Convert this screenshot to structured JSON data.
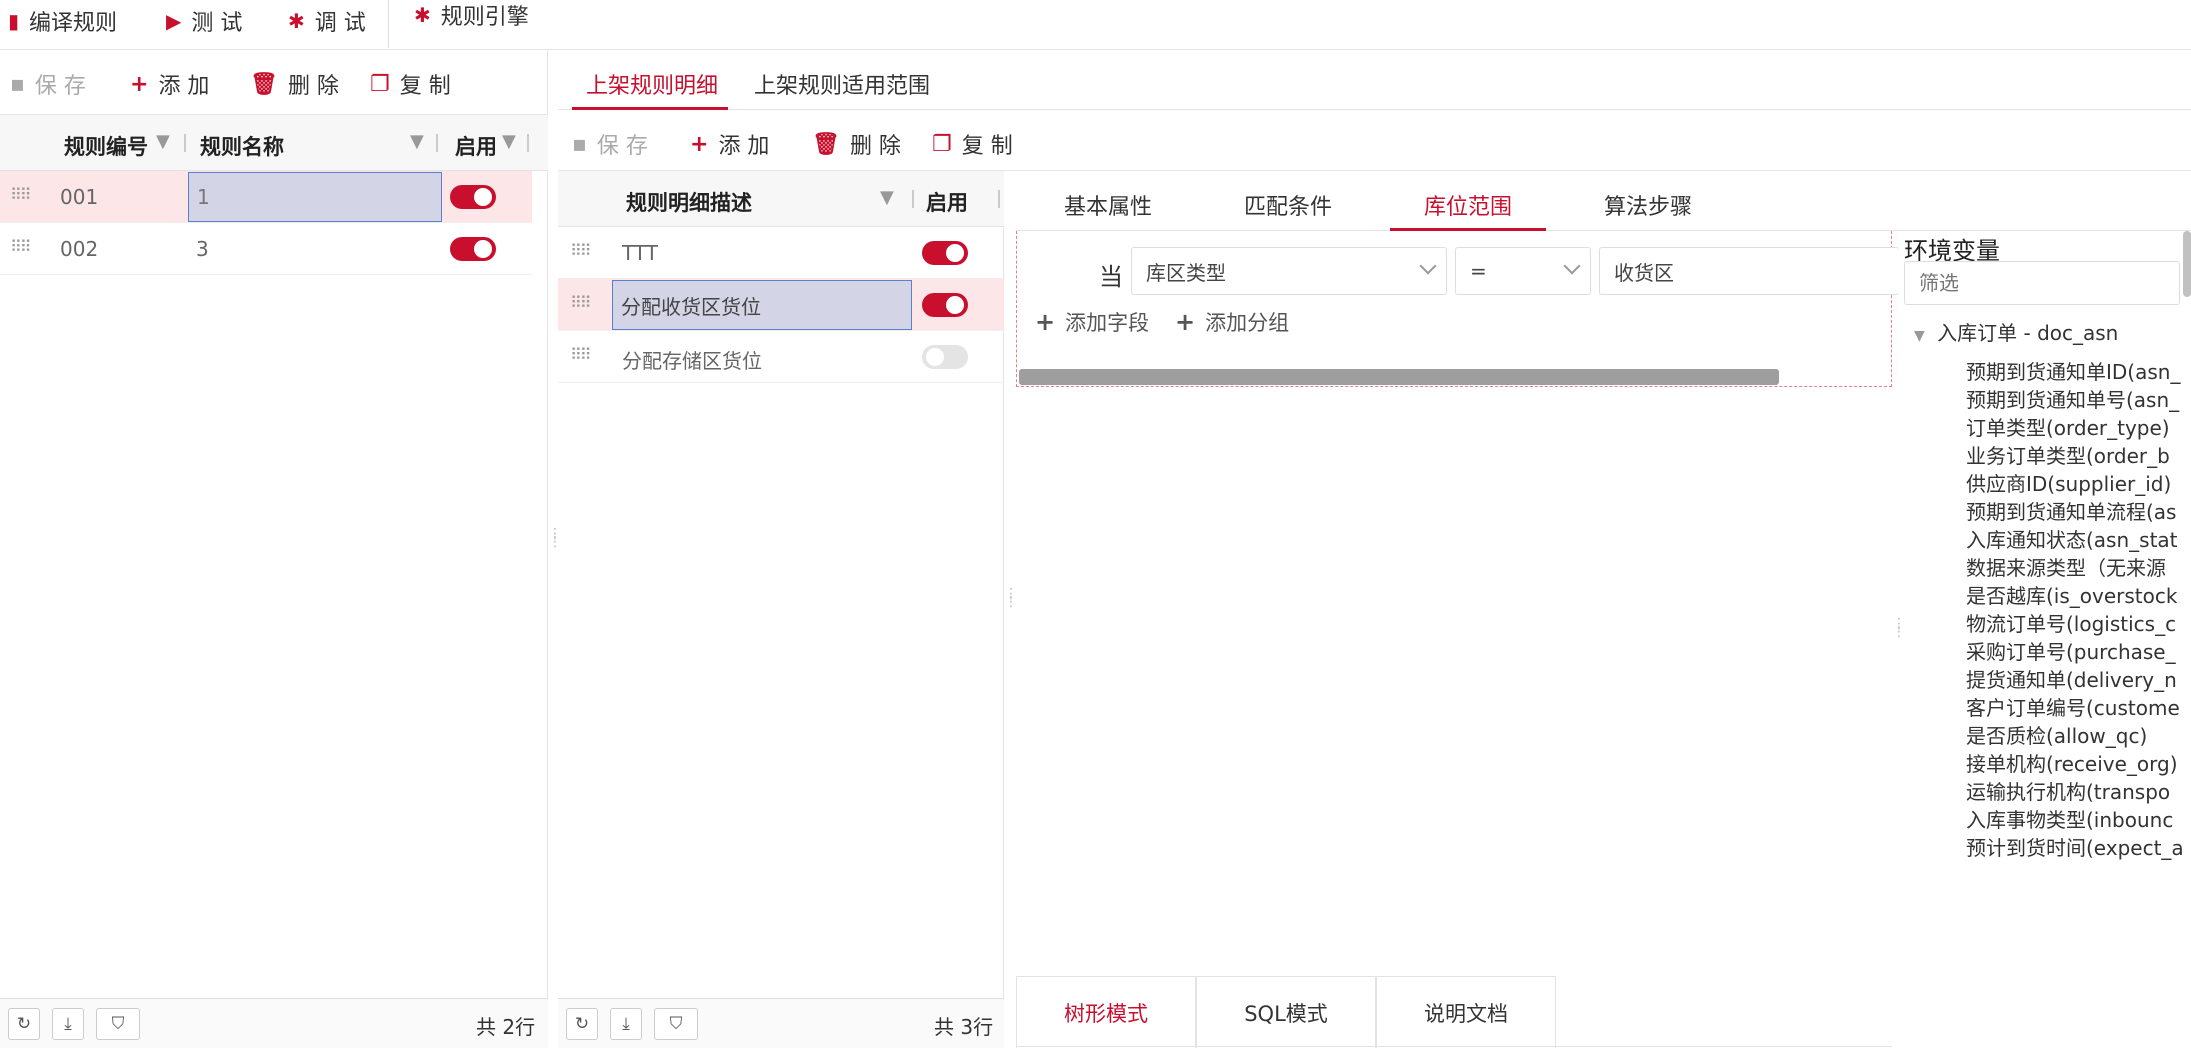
{
  "top_toolbar": {
    "compile": "编译规则",
    "test": "测 试",
    "debug": "调 试",
    "engine": "规则引擎"
  },
  "left_panel": {
    "actions": {
      "save": "保 存",
      "add": "添 加",
      "delete": "删 除",
      "copy": "复 制"
    },
    "columns": {
      "code": "规则编号",
      "name": "规则名称",
      "enabled": "启用"
    },
    "rows": [
      {
        "code": "001",
        "name": "1",
        "enabled": true
      },
      {
        "code": "002",
        "name": "3",
        "enabled": true
      }
    ],
    "footer_count": "共 2行"
  },
  "main_tabs": {
    "tab1": "上架规则明细",
    "tab2": "上架规则适用范围"
  },
  "mid_panel": {
    "actions": {
      "save": "保 存",
      "add": "添 加",
      "delete": "删 除",
      "copy": "复 制"
    },
    "columns": {
      "desc": "规则明细描述",
      "enabled": "启用"
    },
    "rows": [
      {
        "desc": "TTT",
        "enabled": true
      },
      {
        "desc": "分配收货区货位",
        "enabled": true
      },
      {
        "desc": "分配存储区货位",
        "enabled": false
      }
    ],
    "footer_count": "共 3行"
  },
  "detail_tabs": {
    "basic": "基本属性",
    "match": "匹配条件",
    "location": "库位范围",
    "algo": "算法步骤"
  },
  "condition": {
    "when": "当",
    "field": "库区类型",
    "operator": "=",
    "value": "收货区",
    "add_field": "添加字段",
    "add_group": "添加分组"
  },
  "bottom_tabs": {
    "tree": "树形模式",
    "sql": "SQL模式",
    "doc": "说明文档"
  },
  "env": {
    "title": "环境变量",
    "filter_placeholder": "筛选",
    "root": "入库订单 - doc_asn",
    "items": [
      "预期到货通知单ID(asn_",
      "预期到货通知单号(asn_",
      "订单类型(order_type)",
      "业务订单类型(order_b",
      "供应商ID(supplier_id)",
      "预期到货通知单流程(as",
      "入库通知状态(asn_stat",
      "数据来源类型（无来源",
      "是否越库(is_overstock",
      "物流订单号(logistics_c",
      "采购订单号(purchase_",
      "提货通知单(delivery_n",
      "客户订单编号(custome",
      "是否质检(allow_qc)",
      "接单机构(receive_org)",
      "运输执行机构(transpo",
      "入库事物类型(inbounc",
      "预计到货时间(expect_a"
    ]
  }
}
